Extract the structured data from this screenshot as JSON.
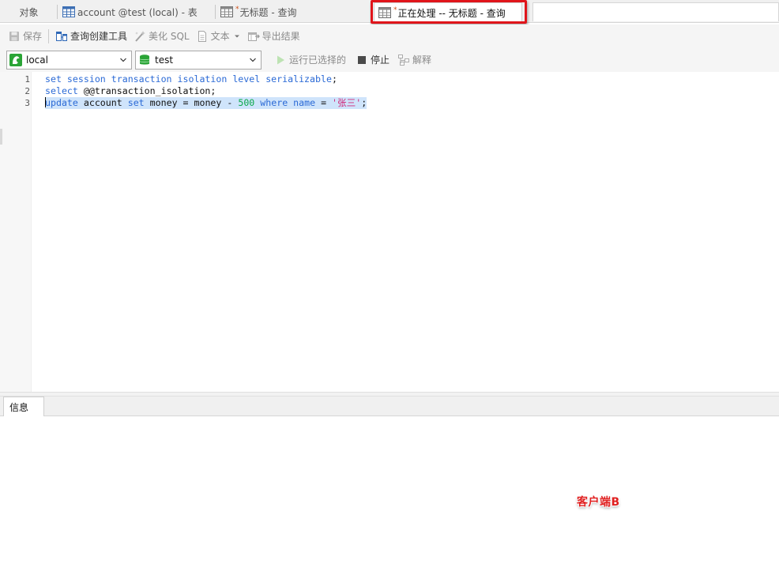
{
  "tabs": {
    "objects": "对象",
    "account": "account @test (local) - 表",
    "untitled": "无标题 - 查询",
    "active": "正在处理 -- 无标题 - 查询",
    "modified_marker": "*"
  },
  "toolbar": {
    "save": "保存",
    "query_builder": "查询创建工具",
    "beautify": "美化 SQL",
    "text": "文本",
    "export": "导出结果"
  },
  "selectors": {
    "connection": "local",
    "database": "test",
    "run_selected": "运行已选择的",
    "stop": "停止",
    "explain": "解释"
  },
  "editor": {
    "line_numbers": [
      "1",
      "2",
      "3"
    ],
    "lines": [
      [
        {
          "t": "set session transaction isolation level serializable",
          "c": "kw"
        },
        {
          "t": ";",
          "c": ""
        }
      ],
      [
        {
          "t": "select",
          "c": "kw"
        },
        {
          "t": " @@transaction_isolation;",
          "c": ""
        }
      ],
      [
        {
          "t": "update",
          "c": "kw"
        },
        {
          "t": " account ",
          "c": ""
        },
        {
          "t": "set",
          "c": "kw"
        },
        {
          "t": " money = money - ",
          "c": ""
        },
        {
          "t": "500",
          "c": "num"
        },
        {
          "t": " ",
          "c": ""
        },
        {
          "t": "where",
          "c": "kw"
        },
        {
          "t": " ",
          "c": ""
        },
        {
          "t": "name",
          "c": "kw"
        },
        {
          "t": " = ",
          "c": ""
        },
        {
          "t": "'张三'",
          "c": "str"
        },
        {
          "t": ";",
          "c": ""
        }
      ]
    ]
  },
  "info_panel": {
    "tab": "信息"
  },
  "annotation": "客户端B",
  "colors": {
    "keyword": "#2b6ad6",
    "number": "#0aa84a",
    "string": "#d02a7a",
    "highlight_box": "#e0151b",
    "selection": "#cfe4fb"
  }
}
